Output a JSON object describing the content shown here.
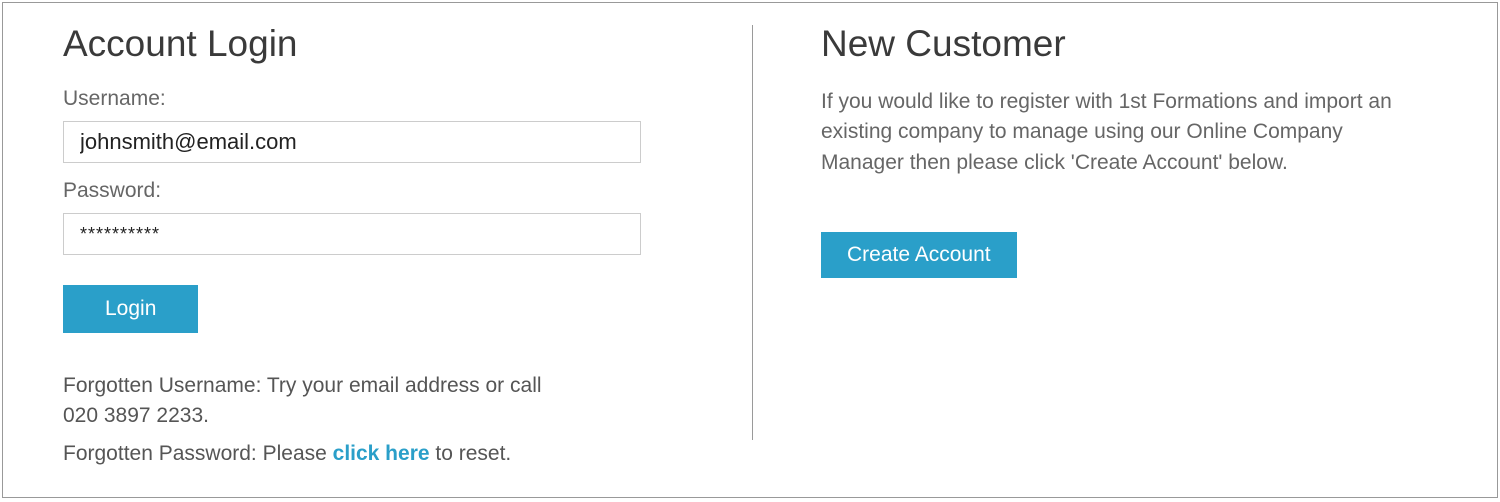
{
  "login": {
    "heading": "Account Login",
    "username_label": "Username:",
    "username_value": "johnsmith@email.com",
    "password_label": "Password:",
    "password_value": "**********",
    "login_button": "Login",
    "forgot_username_text": "Forgotten Username: Try your email address or call 020 3897 2233.",
    "forgot_password_prefix": "Forgotten Password: Please ",
    "forgot_password_link": "click here",
    "forgot_password_suffix": " to reset."
  },
  "new_customer": {
    "heading": "New Customer",
    "body": "If you would like to register with 1st Formations and import an existing company to manage using our Online Company Manager then please click 'Create Account' below.",
    "create_button": "Create Account"
  },
  "colors": {
    "accent": "#2a9fc9"
  }
}
